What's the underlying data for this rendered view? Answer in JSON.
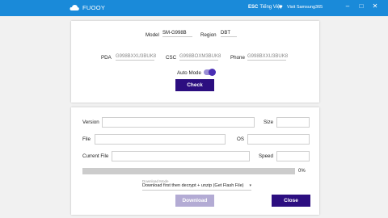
{
  "titlebar": {
    "title": "FUOOY",
    "lang_code": "ESC",
    "lang_name": "Tiếng Việt",
    "visit": "Visit Samsung365",
    "minimize": "–",
    "maximize": "□",
    "close": "✕"
  },
  "device": {
    "model_label": "Model",
    "model_value": "SM-G998B",
    "region_label": "Region",
    "region_value": "DBT",
    "pda_label": "PDA",
    "pda_value": "G998BXXU3BUK8",
    "csc_label": "CSC",
    "csc_value": "G998BOXM3BUK8",
    "phone_label": "Phone",
    "phone_value": "G998BXXU3BUK8",
    "auto_mode_label": "Auto Mode",
    "auto_mode_on": true,
    "check_label": "Check"
  },
  "download": {
    "version_label": "Version",
    "size_label": "Size",
    "file_label": "File",
    "os_label": "OS",
    "current_file_label": "Current File",
    "speed_label": "Speed",
    "progress_percent": 0,
    "progress_text": "0%",
    "mode_label": "Download Mode",
    "mode_value": "Download first then decrypt + unzip (Get Flash File)",
    "download_label": "Download",
    "close_label": "Close"
  }
}
